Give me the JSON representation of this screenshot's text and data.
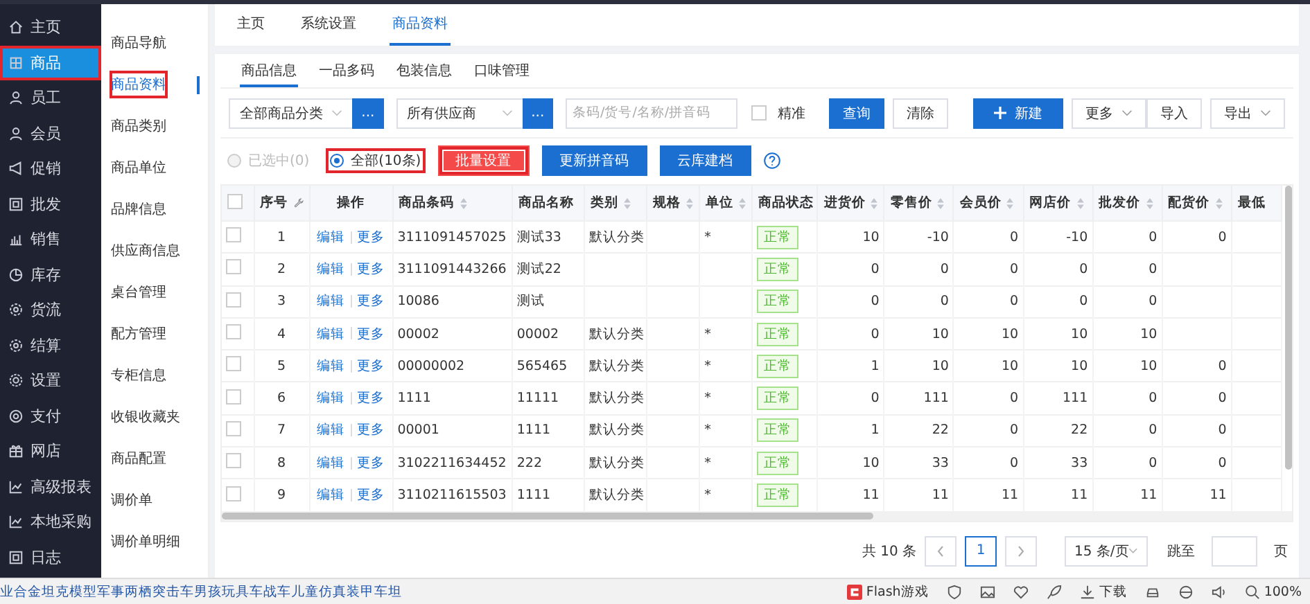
{
  "sidebar": {
    "items": [
      {
        "label": "主页",
        "selected": false,
        "highlighted": false
      },
      {
        "label": "商品",
        "selected": true,
        "highlighted": true
      },
      {
        "label": "员工",
        "selected": false,
        "highlighted": false
      },
      {
        "label": "会员",
        "selected": false,
        "highlighted": false
      },
      {
        "label": "促销",
        "selected": false,
        "highlighted": false
      },
      {
        "label": "批发",
        "selected": false,
        "highlighted": false
      },
      {
        "label": "销售",
        "selected": false,
        "highlighted": false
      },
      {
        "label": "库存",
        "selected": false,
        "highlighted": false
      },
      {
        "label": "货流",
        "selected": false,
        "highlighted": false
      },
      {
        "label": "结算",
        "selected": false,
        "highlighted": false
      },
      {
        "label": "设置",
        "selected": false,
        "highlighted": false
      },
      {
        "label": "支付",
        "selected": false,
        "highlighted": false
      },
      {
        "label": "网店",
        "selected": false,
        "highlighted": false
      },
      {
        "label": "高级报表",
        "selected": false,
        "highlighted": false
      },
      {
        "label": "本地采购",
        "selected": false,
        "highlighted": false
      },
      {
        "label": "日志",
        "selected": false,
        "highlighted": false
      }
    ]
  },
  "subnav": {
    "items": [
      {
        "label": "商品导航",
        "selected": false,
        "highlighted": false
      },
      {
        "label": "商品资料",
        "selected": true,
        "highlighted": true
      },
      {
        "label": "商品类别",
        "selected": false,
        "highlighted": false
      },
      {
        "label": "商品单位",
        "selected": false,
        "highlighted": false
      },
      {
        "label": "品牌信息",
        "selected": false,
        "highlighted": false
      },
      {
        "label": "供应商信息",
        "selected": false,
        "highlighted": false
      },
      {
        "label": "桌台管理",
        "selected": false,
        "highlighted": false
      },
      {
        "label": "配方管理",
        "selected": false,
        "highlighted": false
      },
      {
        "label": "专柜信息",
        "selected": false,
        "highlighted": false
      },
      {
        "label": "收银收藏夹",
        "selected": false,
        "highlighted": false
      },
      {
        "label": "商品配置",
        "selected": false,
        "highlighted": false
      },
      {
        "label": "调价单",
        "selected": false,
        "highlighted": false
      },
      {
        "label": "调价单明细",
        "selected": false,
        "highlighted": false
      }
    ]
  },
  "tabs": [
    {
      "label": "主页",
      "selected": false
    },
    {
      "label": "系统设置",
      "selected": false
    },
    {
      "label": "商品资料",
      "selected": true
    }
  ],
  "subtabs": [
    {
      "label": "商品信息",
      "selected": true
    },
    {
      "label": "一品多码",
      "selected": false
    },
    {
      "label": "包装信息",
      "selected": false
    },
    {
      "label": "口味管理",
      "selected": false
    }
  ],
  "filters": {
    "category": {
      "value": "全部商品分类",
      "button": "..."
    },
    "supplier": {
      "value": "所有供应商",
      "button": "..."
    },
    "search": {
      "placeholder": "条码/货号/名称/拼音码"
    },
    "exact": {
      "label": "精准",
      "checked": false
    },
    "buttons": [
      {
        "label": "查询",
        "kind": "primary"
      },
      {
        "label": "清除",
        "kind": "default"
      },
      {
        "label": "新建",
        "kind": "add"
      },
      {
        "label": "更多",
        "kind": "dropdown"
      },
      {
        "label": "导入",
        "kind": "default"
      },
      {
        "label": "导出",
        "kind": "dropdown"
      }
    ]
  },
  "scope": [
    {
      "label": "已选中(0)",
      "selected": false,
      "disabled": true,
      "highlighted": false
    },
    {
      "label": "全部(10条)",
      "selected": true,
      "disabled": false,
      "highlighted": true
    }
  ],
  "actions": [
    {
      "label": "批量设置",
      "kind": "danger",
      "highlighted": true
    },
    {
      "label": "更新拼音码",
      "kind": "primary",
      "highlighted": false
    },
    {
      "label": "云库建档",
      "kind": "primary",
      "highlighted": false
    }
  ],
  "table": {
    "select_all_checked": false,
    "columns": [
      "序号",
      "操作",
      "商品条码",
      "商品名称",
      "类别",
      "规格",
      "单位",
      "商品状态",
      "进货价",
      "零售价",
      "会员价",
      "网店价",
      "批发价",
      "配货价",
      "最低"
    ],
    "rows": [
      {
        "checked": false,
        "no": "1",
        "actions": [
          "编辑",
          "更多"
        ],
        "barcode": "3111091457025",
        "name": "测试33",
        "category": "默认分类",
        "unit": "*",
        "status": "正常",
        "prices": [
          "10",
          "-10",
          "0",
          "-10",
          "0",
          "0"
        ]
      },
      {
        "checked": false,
        "no": "2",
        "actions": [
          "编辑",
          "更多"
        ],
        "barcode": "3111091443266",
        "name": "测试22",
        "status": "正常",
        "prices": [
          "0",
          "0",
          "0",
          "0",
          "0"
        ]
      },
      {
        "checked": false,
        "no": "3",
        "actions": [
          "编辑",
          "更多"
        ],
        "barcode": "10086",
        "name": "测试",
        "status": "正常",
        "prices": [
          "0",
          "0",
          "0",
          "0",
          "0"
        ]
      },
      {
        "checked": false,
        "no": "4",
        "actions": [
          "编辑",
          "更多"
        ],
        "barcode": "00002",
        "name": "00002",
        "category": "默认分类",
        "unit": "*",
        "status": "正常",
        "prices": [
          "0",
          "10",
          "10",
          "10",
          "10"
        ]
      },
      {
        "checked": false,
        "no": "5",
        "actions": [
          "编辑",
          "更多"
        ],
        "barcode": "00000002",
        "name": "565465",
        "category": "默认分类",
        "unit": "*",
        "status": "正常",
        "prices": [
          "1",
          "10",
          "10",
          "10",
          "10",
          "0"
        ]
      },
      {
        "checked": false,
        "no": "6",
        "actions": [
          "编辑",
          "更多"
        ],
        "barcode": "1111",
        "name": "11111",
        "category": "默认分类",
        "unit": "*",
        "status": "正常",
        "prices": [
          "0",
          "111",
          "0",
          "111",
          "0",
          "0"
        ]
      },
      {
        "checked": false,
        "no": "7",
        "actions": [
          "编辑",
          "更多"
        ],
        "barcode": "00001",
        "name": "1111",
        "category": "默认分类",
        "unit": "*",
        "status": "正常",
        "prices": [
          "1",
          "22",
          "0",
          "22",
          "0",
          "0"
        ]
      },
      {
        "checked": false,
        "no": "8",
        "actions": [
          "编辑",
          "更多"
        ],
        "barcode": "3102211634452",
        "name": "222",
        "category": "默认分类",
        "unit": "*",
        "status": "正常",
        "prices": [
          "10",
          "33",
          "0",
          "33",
          "0",
          "0"
        ]
      },
      {
        "checked": false,
        "no": "9",
        "actions": [
          "编辑",
          "更多"
        ],
        "barcode": "3110211615503",
        "name": "1111",
        "category": "默认分类",
        "unit": "*",
        "status": "正常",
        "prices": [
          "11",
          "11",
          "11",
          "11",
          "11",
          "11"
        ]
      }
    ]
  },
  "pagination": {
    "total": "共 10 条",
    "pages": [
      {
        "label": "1",
        "selected": true
      }
    ],
    "page_size": "15 条/页",
    "jump_label": "跳至",
    "page_unit": "页"
  },
  "status_bar": {
    "news": "业合金坦克模型军事两栖突击车男孩玩具车战车儿童仿真装甲车坦",
    "game": "Flash游戏",
    "download": "下载",
    "zoom": "100%"
  }
}
